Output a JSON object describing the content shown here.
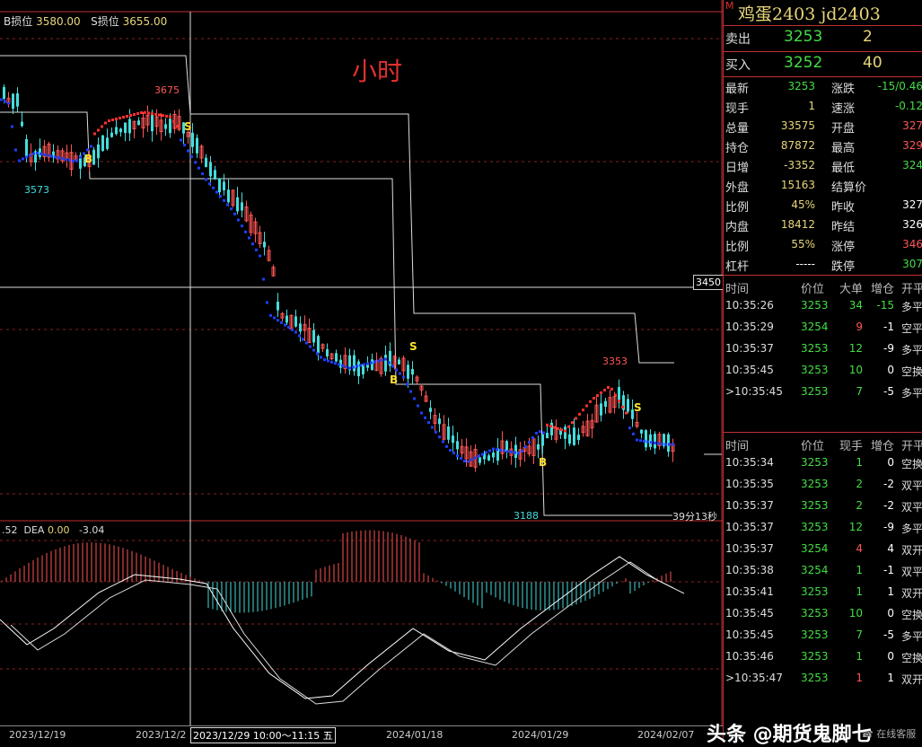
{
  "header": {
    "b_stop_label": "B损位",
    "b_stop_value": "3580.00",
    "s_stop_label": "S损位",
    "s_stop_value": "3655.00"
  },
  "chart": {
    "period_label": "小时",
    "price_tag": "3450",
    "timer_label": "39分13秒",
    "annotations": {
      "high1": "3675",
      "low1": "3573",
      "high2": "3353",
      "low2": "3188"
    },
    "signals": {
      "b": "B",
      "s": "S"
    }
  },
  "macd": {
    "dif_text": ".52",
    "dea_label": "DEA",
    "dea_value": "0.00",
    "macd_value": "-3.04"
  },
  "xaxis": {
    "labels": [
      "2023/12/19",
      "2023/12/2",
      "2024/01/18",
      "2024/01/29",
      "2024/02/07"
    ],
    "cursor_label": "2023/12/29 10:00～11:15 五"
  },
  "panel": {
    "marker": "M",
    "title": "鸡蛋2403   jd2403",
    "ask_label": "卖出",
    "ask_price": "3253",
    "ask_qty": "2",
    "bid_label": "买入",
    "bid_price": "3252",
    "bid_qty": "40",
    "stats": [
      {
        "k1": "最新",
        "v1": "3253",
        "c1": "g",
        "k2": "涨跌",
        "v2": "-15/0.46",
        "c2": "g"
      },
      {
        "k1": "现手",
        "v1": "1",
        "c1": "y",
        "k2": "速涨",
        "v2": "-0.12",
        "c2": "g"
      },
      {
        "k1": "总量",
        "v1": "33575",
        "c1": "y",
        "k2": "开盘",
        "v2": "327",
        "c2": "r"
      },
      {
        "k1": "持仓",
        "v1": "87872",
        "c1": "y",
        "k2": "最高",
        "v2": "329",
        "c2": "r"
      },
      {
        "k1": "日增",
        "v1": "-3352",
        "c1": "y",
        "k2": "最低",
        "v2": "324",
        "c2": "g"
      },
      {
        "k1": "外盘",
        "v1": "15163",
        "c1": "y",
        "k2": "结算价",
        "v2": "",
        "c2": "w"
      },
      {
        "k1": "比例",
        "v1": "45%",
        "c1": "y",
        "k2": "昨收",
        "v2": "327",
        "c2": "w"
      },
      {
        "k1": "内盘",
        "v1": "18412",
        "c1": "y",
        "k2": "昨结",
        "v2": "326",
        "c2": "w"
      },
      {
        "k1": "比例",
        "v1": "55%",
        "c1": "y",
        "k2": "涨停",
        "v2": "346",
        "c2": "r"
      },
      {
        "k1": "杠杆",
        "v1": "-----",
        "c1": "w",
        "k2": "跌停",
        "v2": "307",
        "c2": "g"
      }
    ],
    "big_table": {
      "headers": [
        "时间",
        "价位",
        "大单",
        "增仓",
        "开平"
      ],
      "rows": [
        {
          "t": "10:35:26",
          "p": "3253",
          "pc": "g",
          "q": "34",
          "qc": "g",
          "d": "-15",
          "dc": "g",
          "o": "多平"
        },
        {
          "t": "10:35:29",
          "p": "3254",
          "pc": "g",
          "q": "9",
          "qc": "r",
          "d": "-1",
          "dc": "w",
          "o": "空平"
        },
        {
          "t": "10:35:37",
          "p": "3253",
          "pc": "g",
          "q": "12",
          "qc": "g",
          "d": "-9",
          "dc": "w",
          "o": "多平"
        },
        {
          "t": "10:35:45",
          "p": "3253",
          "pc": "g",
          "q": "10",
          "qc": "g",
          "d": "0",
          "dc": "w",
          "o": "空换"
        },
        {
          "t": ">10:35:45",
          "p": "3253",
          "pc": "g",
          "q": "7",
          "qc": "g",
          "d": "-5",
          "dc": "w",
          "o": "多平"
        }
      ]
    },
    "tick_table": {
      "headers": [
        "时间",
        "价位",
        "现手",
        "增仓",
        "开平"
      ],
      "rows": [
        {
          "t": "10:35:34",
          "p": "3253",
          "pc": "g",
          "q": "1",
          "qc": "g",
          "d": "0",
          "dc": "w",
          "o": "空换"
        },
        {
          "t": "10:35:35",
          "p": "3253",
          "pc": "g",
          "q": "2",
          "qc": "g",
          "d": "-2",
          "dc": "w",
          "o": "双平"
        },
        {
          "t": "10:35:37",
          "p": "3253",
          "pc": "g",
          "q": "2",
          "qc": "g",
          "d": "-2",
          "dc": "w",
          "o": "双平"
        },
        {
          "t": "10:35:37",
          "p": "3253",
          "pc": "g",
          "q": "12",
          "qc": "g",
          "d": "-9",
          "dc": "w",
          "o": "多平"
        },
        {
          "t": "10:35:37",
          "p": "3254",
          "pc": "g",
          "q": "4",
          "qc": "r",
          "d": "4",
          "dc": "w",
          "o": "双开"
        },
        {
          "t": "10:35:38",
          "p": "3254",
          "pc": "g",
          "q": "1",
          "qc": "g",
          "d": "-1",
          "dc": "w",
          "o": "双平"
        },
        {
          "t": "10:35:41",
          "p": "3253",
          "pc": "g",
          "q": "1",
          "qc": "g",
          "d": "1",
          "dc": "w",
          "o": "双开"
        },
        {
          "t": "10:35:45",
          "p": "3253",
          "pc": "g",
          "q": "10",
          "qc": "g",
          "d": "0",
          "dc": "w",
          "o": "空换"
        },
        {
          "t": "10:35:45",
          "p": "3253",
          "pc": "g",
          "q": "7",
          "qc": "g",
          "d": "-5",
          "dc": "w",
          "o": "多平"
        },
        {
          "t": "10:35:46",
          "p": "3253",
          "pc": "g",
          "q": "1",
          "qc": "g",
          "d": "0",
          "dc": "w",
          "o": "空换"
        },
        {
          "t": ">10:35:47",
          "p": "3253",
          "pc": "g",
          "q": "1",
          "qc": "r",
          "d": "1",
          "dc": "w",
          "o": "双开"
        }
      ]
    },
    "online_label": "在线客服"
  },
  "watermark": "头条 @期货鬼脚七",
  "colors": {
    "up": "#ff5555",
    "down": "#44dddd",
    "ma_blue": "#1f3fff",
    "grid_red": "#8b2020",
    "accent_yellow": "#e8d67a"
  }
}
